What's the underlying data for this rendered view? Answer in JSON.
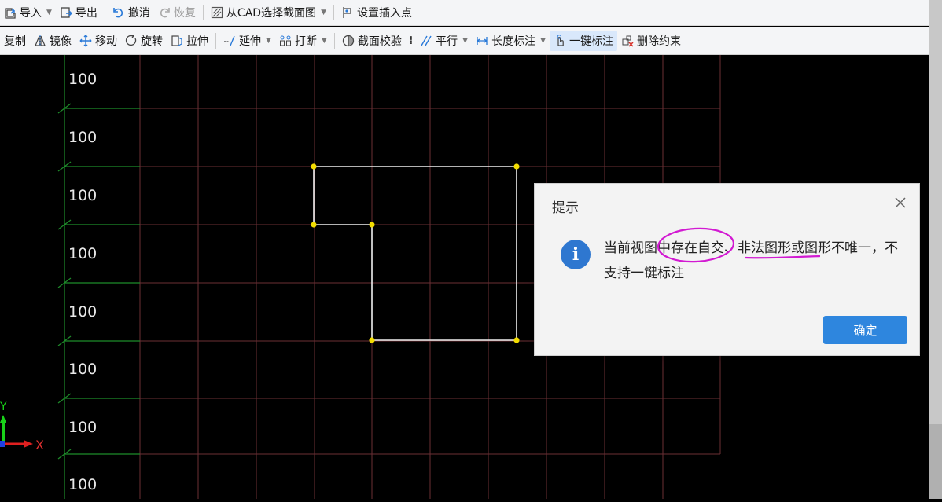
{
  "toolbar1": {
    "import": "导入",
    "export": "导出",
    "undo": "撤消",
    "redo": "恢复",
    "from_cad": "从CAD选择截面图",
    "set_insert_point": "设置插入点"
  },
  "toolbar2": {
    "copy": "复制",
    "mirror": "镜像",
    "move": "移动",
    "rotate": "旋转",
    "stretch": "拉伸",
    "extend": "延伸",
    "break": "打断",
    "section_check": "截面校验",
    "parallel": "平行",
    "length_dim": "长度标注",
    "one_key_dim": "一键标注",
    "delete_constraint": "删除约束"
  },
  "canvas": {
    "row_labels": [
      "100",
      "100",
      "100",
      "100",
      "100",
      "100",
      "100",
      "100"
    ],
    "axis_x": "X",
    "axis_y": "Y"
  },
  "dialog": {
    "title": "提示",
    "message": "当前视图中存在自交、非法图形或图形不唯一，不支持一键标注",
    "ok": "确定"
  },
  "colors": {
    "grid": "#6b2f35",
    "axis_green": "#1e8c2a",
    "shape": "#ffffff",
    "vertex": "#f2dc00",
    "annotation": "#d21ad2",
    "primary": "#2e86de"
  }
}
